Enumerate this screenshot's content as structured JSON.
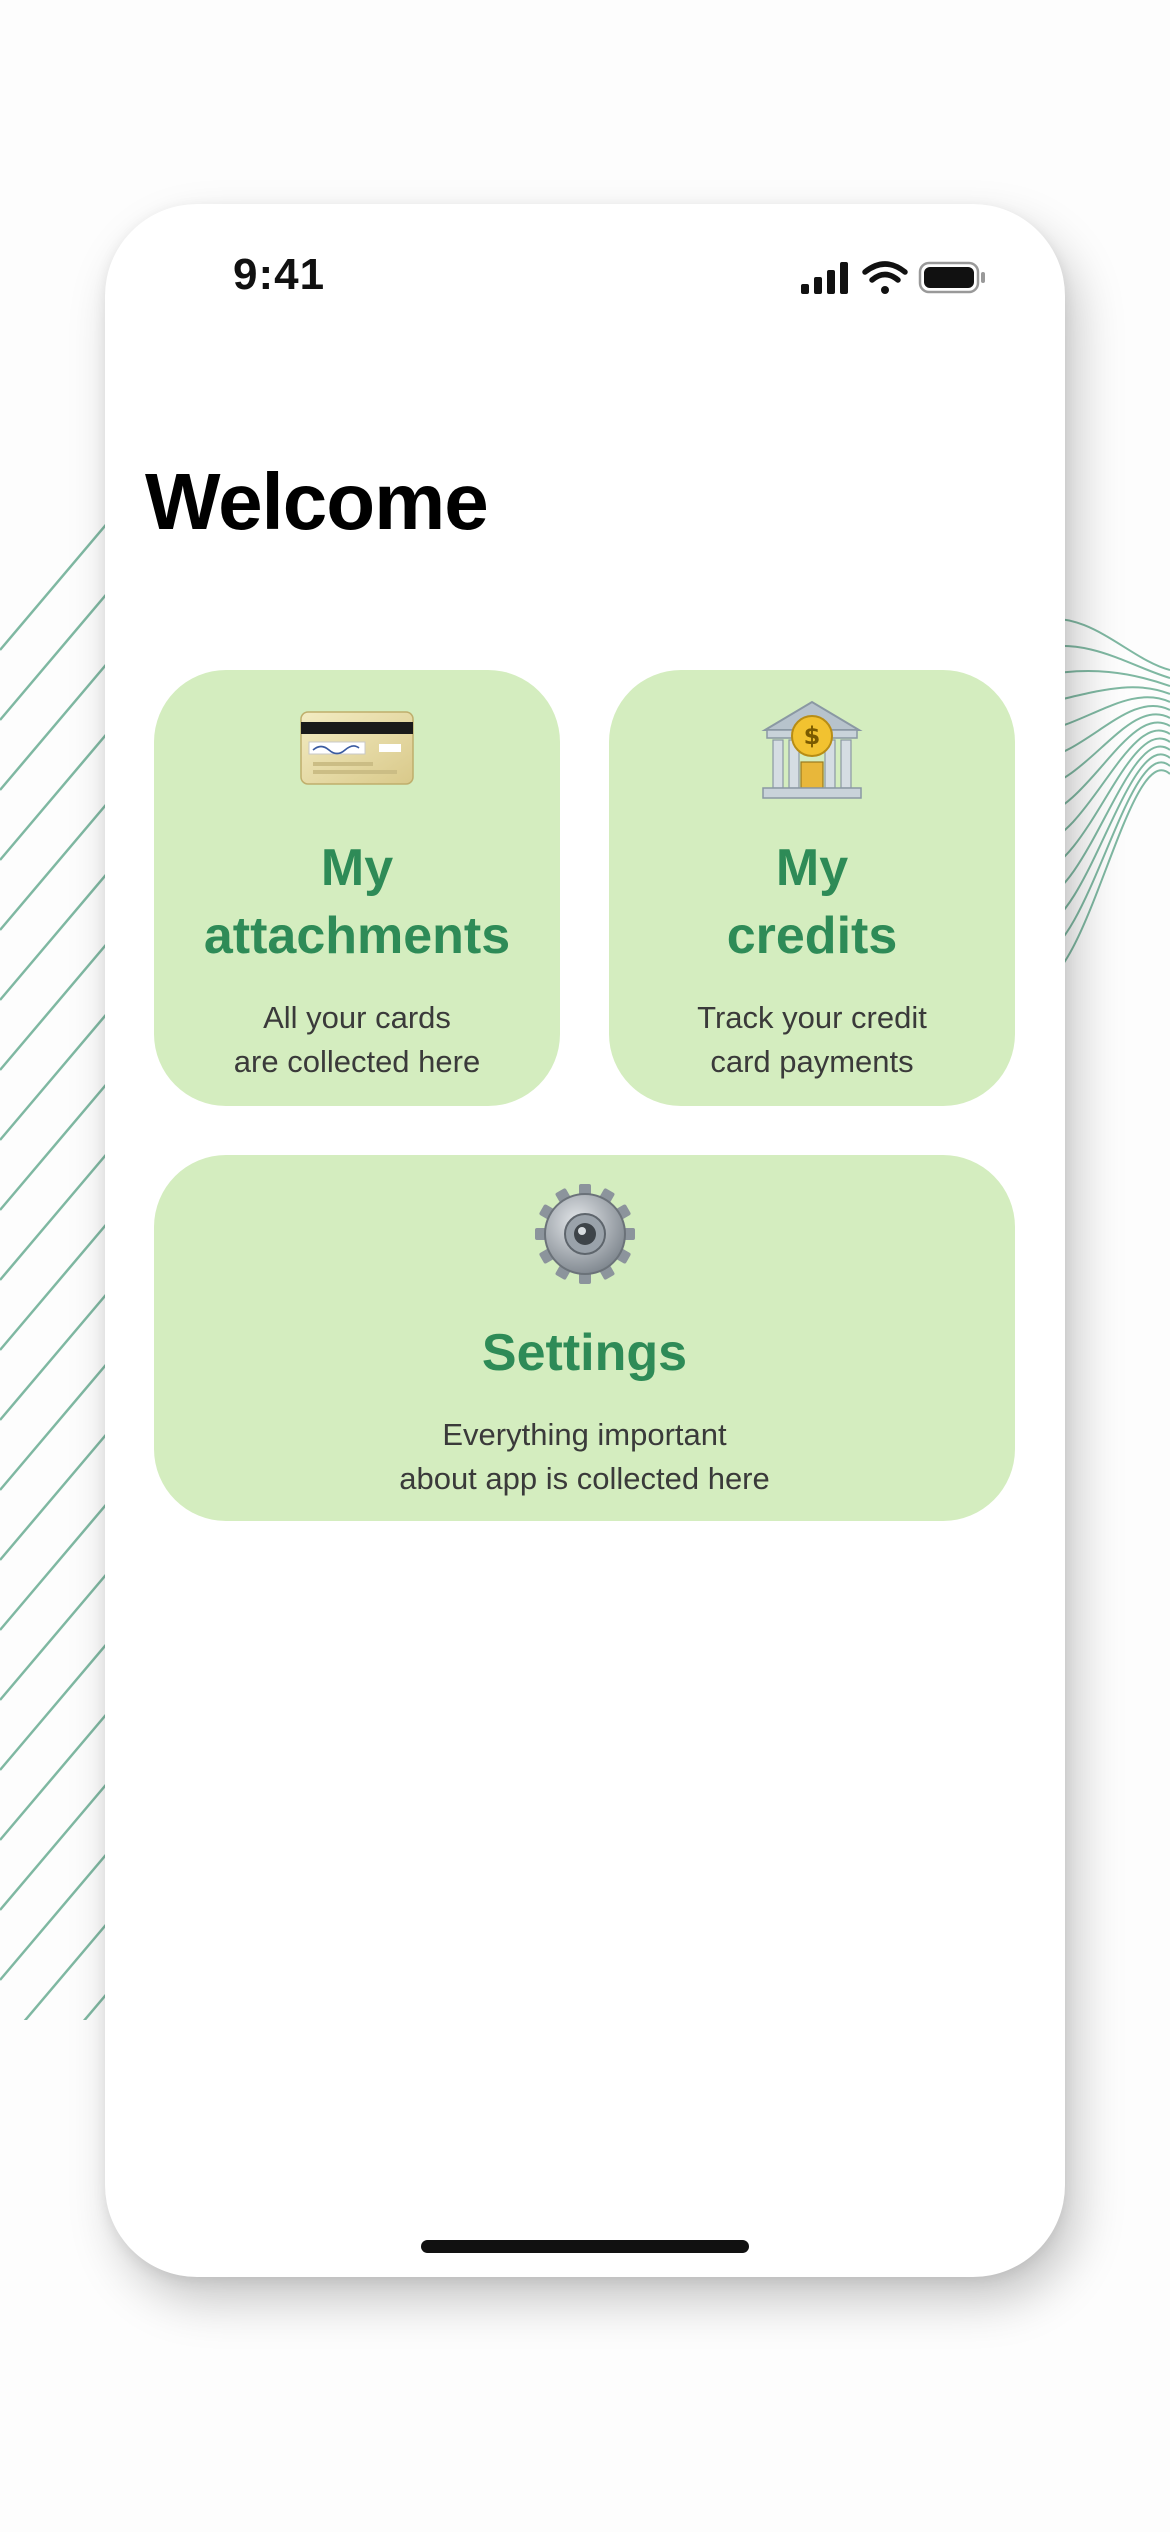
{
  "status_bar": {
    "time": "9:41",
    "signal_icon": "cellular-signal-icon",
    "wifi_icon": "wifi-icon",
    "battery_icon": "battery-icon"
  },
  "header": {
    "title": "Welcome"
  },
  "cards": [
    {
      "icon": "credit-card-icon",
      "title_line1": "My",
      "title_line2": "attachments",
      "desc_line1": "All your cards",
      "desc_line2": "are collected here"
    },
    {
      "icon": "bank-icon",
      "title_line1": "My",
      "title_line2": "credits",
      "desc_line1": "Track your credit",
      "desc_line2": "card payments"
    },
    {
      "icon": "gear-icon",
      "title_line1": "Settings",
      "desc_line1": "Everything important",
      "desc_line2": "about app is collected here"
    }
  ],
  "colors": {
    "card_background": "#d4edbf",
    "card_title": "#2e8b57",
    "card_text": "#3a3a3a",
    "decoration_lines": "#7fb8a2"
  }
}
